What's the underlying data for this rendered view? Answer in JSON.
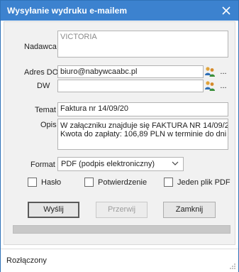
{
  "window": {
    "title": "Wysyłanie wydruku e-mailem",
    "close_icon": "close-icon"
  },
  "form": {
    "sender": {
      "label": "Nadawca",
      "value": "VICTORIA"
    },
    "to": {
      "label": "Adres DO",
      "value": "biuro@nabywcaabc.pl",
      "icon": "address-book-icon",
      "more_label": "..."
    },
    "cc": {
      "label": "DW",
      "value": "",
      "icon": "address-book-icon",
      "more_label": "..."
    },
    "subject": {
      "label": "Temat",
      "value": "Faktura nr 14/09/20"
    },
    "description": {
      "label": "Opis",
      "lines": [
        "W załączniku znajduje się FAKTURA NR 14/09/2",
        "Kwota do zapłaty: 106,89 PLN w terminie do dni"
      ]
    },
    "format": {
      "label": "Format",
      "selected": "PDF (podpis elektroniczny)"
    },
    "options": [
      {
        "label": "Hasło",
        "checked": false
      },
      {
        "label": "Potwierdzenie",
        "checked": false
      },
      {
        "label": "Jeden plik PDF",
        "checked": false
      }
    ]
  },
  "buttons": {
    "send": "Wyślij",
    "stop": "Przerwij",
    "close": "Zamknij"
  },
  "progress": {
    "value": 0
  },
  "status": {
    "text": "Rozłączony"
  },
  "colors": {
    "titlebar": "#3c82cf",
    "panel": "#f1f1f1",
    "border": "#b4b4b4"
  }
}
